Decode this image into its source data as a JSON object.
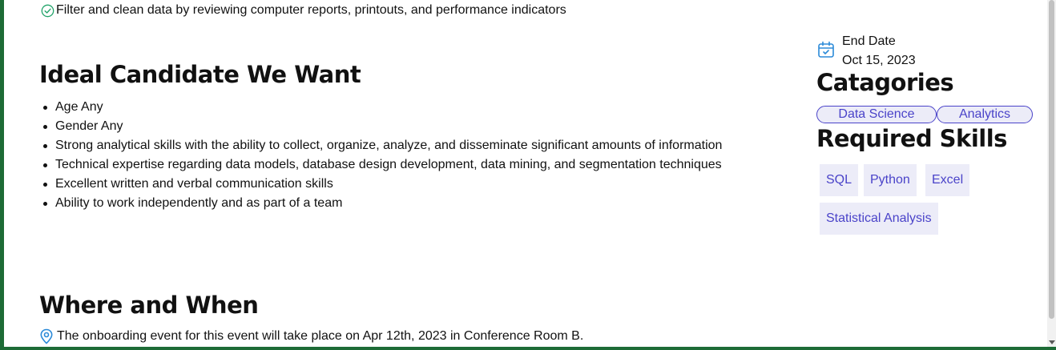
{
  "responsibilities": {
    "last_item": "Filter and clean data by reviewing computer reports, printouts, and performance indicators"
  },
  "ideal_candidate": {
    "heading": "Ideal Candidate We Want",
    "items": [
      "Age Any",
      "Gender Any",
      "Strong analytical skills with the ability to collect, organize, analyze, and disseminate significant amounts of information",
      "Technical expertise regarding data models, database design development, data mining, and segmentation techniques",
      "Excellent written and verbal communication skills",
      "Ability to work independently and as part of a team"
    ]
  },
  "where_when": {
    "heading": "Where and When",
    "text": "The onboarding event for this event will take place on Apr 12th, 2023 in Conference Room B."
  },
  "sidebar": {
    "cut_text": "·· · ·",
    "end_date_label": "End Date",
    "end_date_value": "Oct 15, 2023",
    "categories_heading": "Catagories",
    "categories": [
      "Data Science",
      "Analytics"
    ],
    "skills_heading": "Required Skills",
    "skills": [
      "SQL",
      "Python",
      "Excel",
      "Statistical Analysis"
    ]
  },
  "colors": {
    "accent": "#4a43c9",
    "chip_bg": "#ececf8",
    "icon_green": "#22a36a",
    "icon_blue": "#2b8ad8",
    "frame_green": "#1d6b36"
  },
  "icons": {
    "responsibility": "check-circle-icon",
    "location": "map-pin-icon",
    "date": "calendar-check-icon"
  }
}
